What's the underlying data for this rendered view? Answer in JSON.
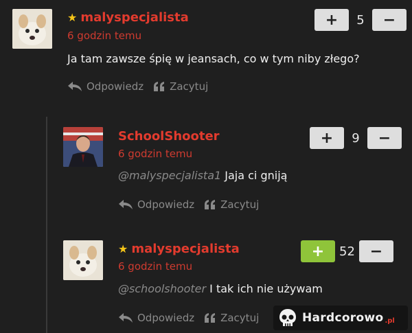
{
  "comments": [
    {
      "author": "malyspecjalista",
      "starred": true,
      "time": "6 godzin temu",
      "mention": "",
      "text": "Ja tam zawsze śpię w jeansach, co w tym niby złego?",
      "votes": 5,
      "upvoted": false,
      "reply_label": "Odpowiedz",
      "quote_label": "Zacytuj"
    },
    {
      "author": "SchoolShooter",
      "starred": false,
      "time": "6 godzin temu",
      "mention": "@malyspecjalista1",
      "text": "Jaja ci gniją",
      "votes": 9,
      "upvoted": false,
      "reply_label": "Odpowiedz",
      "quote_label": "Zacytuj"
    },
    {
      "author": "malyspecjalista",
      "starred": true,
      "time": "6 godzin temu",
      "mention": "@schoolshooter",
      "text": "I tak ich nie używam",
      "votes": 52,
      "upvoted": true,
      "reply_label": "Odpowiedz",
      "quote_label": "Zacytuj"
    }
  ],
  "vote": {
    "plus": "+",
    "minus": "−"
  },
  "logo": {
    "text": "Hardcorowo",
    "suffix": ".pl"
  },
  "colors": {
    "author": "#e33b2e",
    "star": "#f5c518",
    "upvote_active": "#8fc43a",
    "background": "#1f1f1f"
  }
}
